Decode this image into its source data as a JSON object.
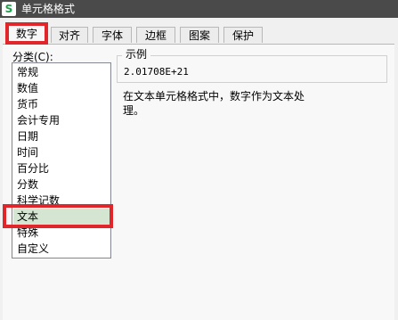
{
  "window": {
    "title": "单元格格式",
    "icon_text": "S",
    "accent_color": "#e0262b",
    "app_icon_color": "#1e9e4a"
  },
  "tabs": [
    {
      "label": "数字",
      "active": true
    },
    {
      "label": "对齐",
      "active": false
    },
    {
      "label": "字体",
      "active": false
    },
    {
      "label": "边框",
      "active": false
    },
    {
      "label": "图案",
      "active": false
    },
    {
      "label": "保护",
      "active": false
    }
  ],
  "category": {
    "label": "分类(C):",
    "selected": "文本",
    "items": [
      "常规",
      "数值",
      "货币",
      "会计专用",
      "日期",
      "时间",
      "百分比",
      "分数",
      "科学记数",
      "文本",
      "特殊",
      "自定义"
    ]
  },
  "example": {
    "legend": "示例",
    "value": "2.01708E+21"
  },
  "description": {
    "line1": "在文本单元格格式中，数字作为文本处",
    "line2": "理。"
  }
}
